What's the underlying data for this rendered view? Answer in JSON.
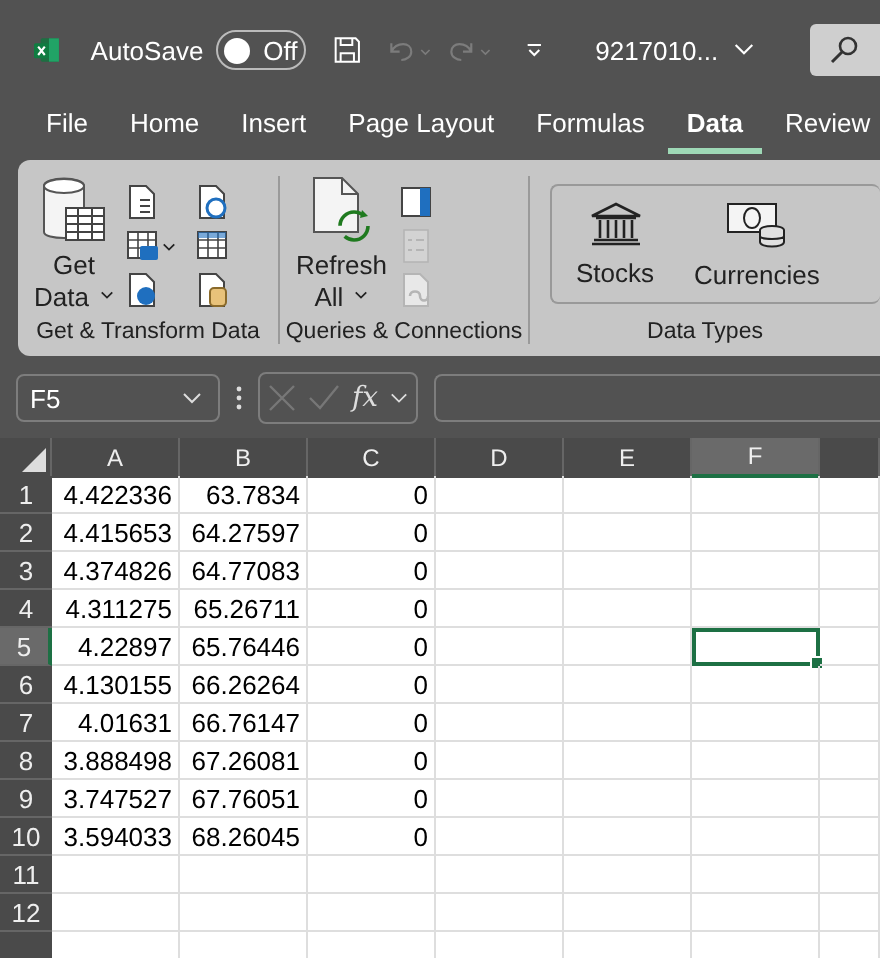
{
  "title_bar": {
    "autosave_label": "AutoSave",
    "autosave": {
      "label": "Off",
      "on": false
    },
    "file_name": "9217010...",
    "quick_access": [
      {
        "kind": "save",
        "disabled": false
      },
      {
        "kind": "undo",
        "disabled": true
      },
      {
        "kind": "redo",
        "disabled": true
      },
      {
        "kind": "customize",
        "disabled": false
      }
    ]
  },
  "menu_tabs": [
    {
      "label": "File",
      "selected": false
    },
    {
      "label": "Home",
      "selected": false
    },
    {
      "label": "Insert",
      "selected": false
    },
    {
      "label": "Page Layout",
      "selected": false
    },
    {
      "label": "Formulas",
      "selected": false
    },
    {
      "label": "Data",
      "selected": true
    },
    {
      "label": "Review",
      "selected": false
    }
  ],
  "ribbon": {
    "groups": [
      {
        "label": "Get & Transform Data",
        "large_button": {
          "label_top": "Get",
          "label_bottom": "Data",
          "kind": "get-data"
        },
        "small_buttons": [
          {
            "kind": "text",
            "disabled": false
          },
          {
            "kind": "picture-table",
            "disabled": false
          },
          {
            "kind": "web",
            "disabled": false
          },
          {
            "kind": "recent",
            "disabled": false
          },
          {
            "kind": "table",
            "disabled": false
          },
          {
            "kind": "connections",
            "disabled": false
          }
        ]
      },
      {
        "label": "Queries & Connections",
        "large_button": {
          "label_top": "Refresh",
          "label_bottom": "All",
          "kind": "refresh"
        },
        "small_buttons": [
          {
            "kind": "panel",
            "disabled": false
          },
          {
            "kind": "list",
            "disabled": true
          },
          {
            "kind": "links",
            "disabled": true
          }
        ]
      },
      {
        "label": "Data Types",
        "data_types": [
          {
            "label": "Stocks",
            "kind": "stocks"
          },
          {
            "label": "Currencies",
            "kind": "currencies"
          }
        ]
      }
    ]
  },
  "formula_bar": {
    "name_box": "F5",
    "function_label": "fx",
    "cancel_disabled": true,
    "enter_disabled": true
  },
  "sheet": {
    "columns": [
      {
        "label": "A",
        "selected": false
      },
      {
        "label": "B",
        "selected": false
      },
      {
        "label": "C",
        "selected": false
      },
      {
        "label": "D",
        "selected": false
      },
      {
        "label": "E",
        "selected": false
      },
      {
        "label": "F",
        "selected": true
      }
    ],
    "rows": [
      {
        "label": "1",
        "selected": false,
        "cells": [
          "4.422336",
          "63.7834",
          "0"
        ]
      },
      {
        "label": "2",
        "selected": false,
        "cells": [
          "4.415653",
          "64.27597",
          "0"
        ]
      },
      {
        "label": "3",
        "selected": false,
        "cells": [
          "4.374826",
          "64.77083",
          "0"
        ]
      },
      {
        "label": "4",
        "selected": false,
        "cells": [
          "4.311275",
          "65.26711",
          "0"
        ]
      },
      {
        "label": "5",
        "selected": true,
        "cells": [
          "4.22897",
          "65.76446",
          "0"
        ]
      },
      {
        "label": "6",
        "selected": false,
        "cells": [
          "4.130155",
          "66.26264",
          "0"
        ]
      },
      {
        "label": "7",
        "selected": false,
        "cells": [
          "4.01631",
          "66.76147",
          "0"
        ]
      },
      {
        "label": "8",
        "selected": false,
        "cells": [
          "3.888498",
          "67.26081",
          "0"
        ]
      },
      {
        "label": "9",
        "selected": false,
        "cells": [
          "3.747527",
          "67.76051",
          "0"
        ]
      },
      {
        "label": "10",
        "selected": false,
        "cells": [
          "3.594033",
          "68.26045",
          "0"
        ]
      },
      {
        "label": "11",
        "selected": false
      },
      {
        "label": "12",
        "selected": false
      }
    ]
  }
}
